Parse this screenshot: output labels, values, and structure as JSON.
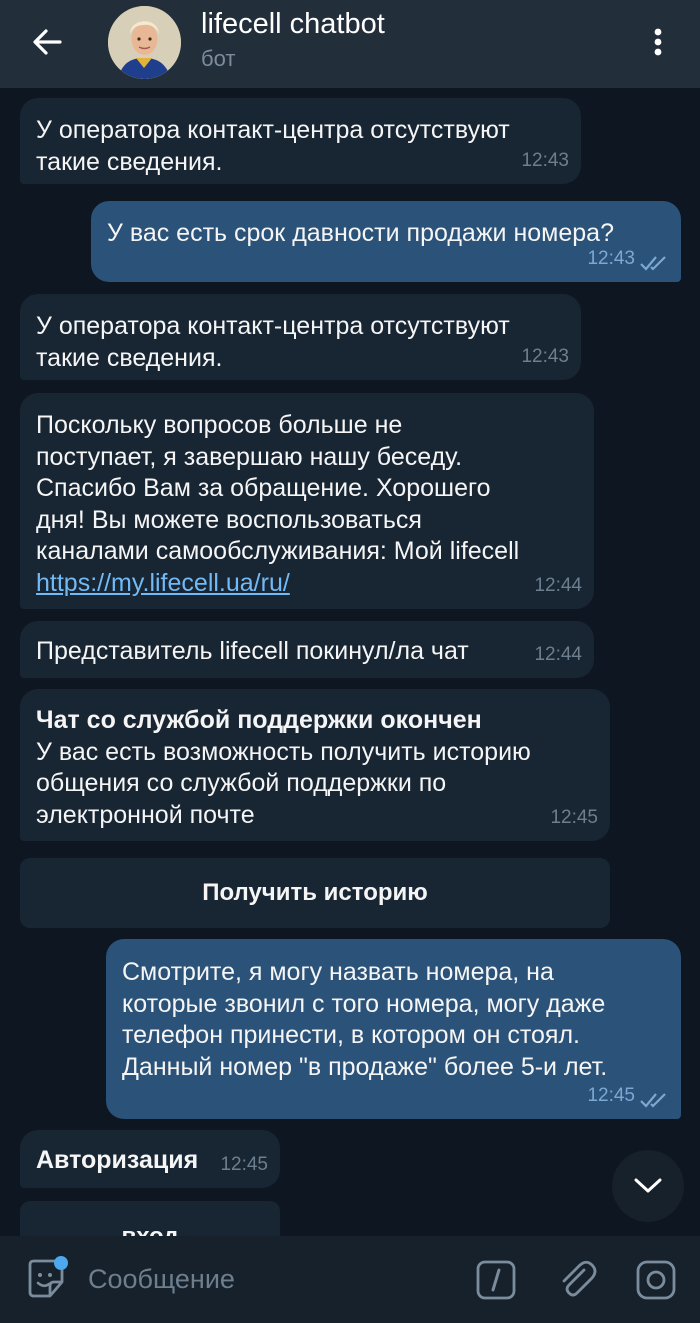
{
  "header": {
    "title": "lifecell chatbot",
    "subtitle": "бот",
    "back_icon": "arrow-left-icon",
    "menu_icon": "more-vertical-icon"
  },
  "messages": [
    {
      "direction": "in",
      "text": "У оператора контакт-центра отсутствуют\nтакие сведения.",
      "time": "12:43"
    },
    {
      "direction": "out",
      "text": "У вас есть срок давности продажи номера?",
      "time": "12:43",
      "status": "read"
    },
    {
      "direction": "in",
      "text": "У оператора контакт-центра отсутствуют\nтакие сведения.",
      "time": "12:43"
    },
    {
      "direction": "in",
      "text": "Поскольку вопросов больше не\nпоступает, я завершаю нашу беседу.\nСпасибо Вам за обращение. Хорошего\nдня! Вы можете воспользоваться\nканалами самообслуживания: Мой lifecell",
      "link": "https://my.lifecell.ua/ru/",
      "time": "12:44"
    },
    {
      "direction": "in",
      "text": "Представитель lifecell покинул/ла чат",
      "time": "12:44"
    },
    {
      "direction": "in",
      "bold_title": "Чат со службой поддержки окончен",
      "text": "У вас есть возможность получить историю\nобщения со службой поддержки по\nэлектронной почте",
      "time": "12:45"
    },
    {
      "direction": "out",
      "text": "Смотрите, я могу назвать номера, на\nкоторые звонил с того номера, могу даже\nтелефон принести, в котором он стоял.\nДанный номер \"в продаже\" более 5-и лет.",
      "time": "12:45",
      "status": "read"
    },
    {
      "direction": "in",
      "bold_title": "Авторизация",
      "time": "12:45"
    }
  ],
  "keyboard_buttons": [
    "Получить историю",
    "вход"
  ],
  "input": {
    "placeholder": "Сообщение",
    "emoji_icon": "sticker-smile-icon",
    "commands_icon": "bot-command-icon",
    "attach_icon": "paperclip-icon",
    "camera_icon": "camera-icon"
  },
  "scroll_icon": "chevron-down-icon",
  "colors": {
    "background": "#0e1621",
    "header": "#222e3a",
    "incoming_bubble": "#182533",
    "outgoing_bubble": "#2b5278",
    "link": "#71baf5",
    "read_ticks": "#7da8d3"
  }
}
